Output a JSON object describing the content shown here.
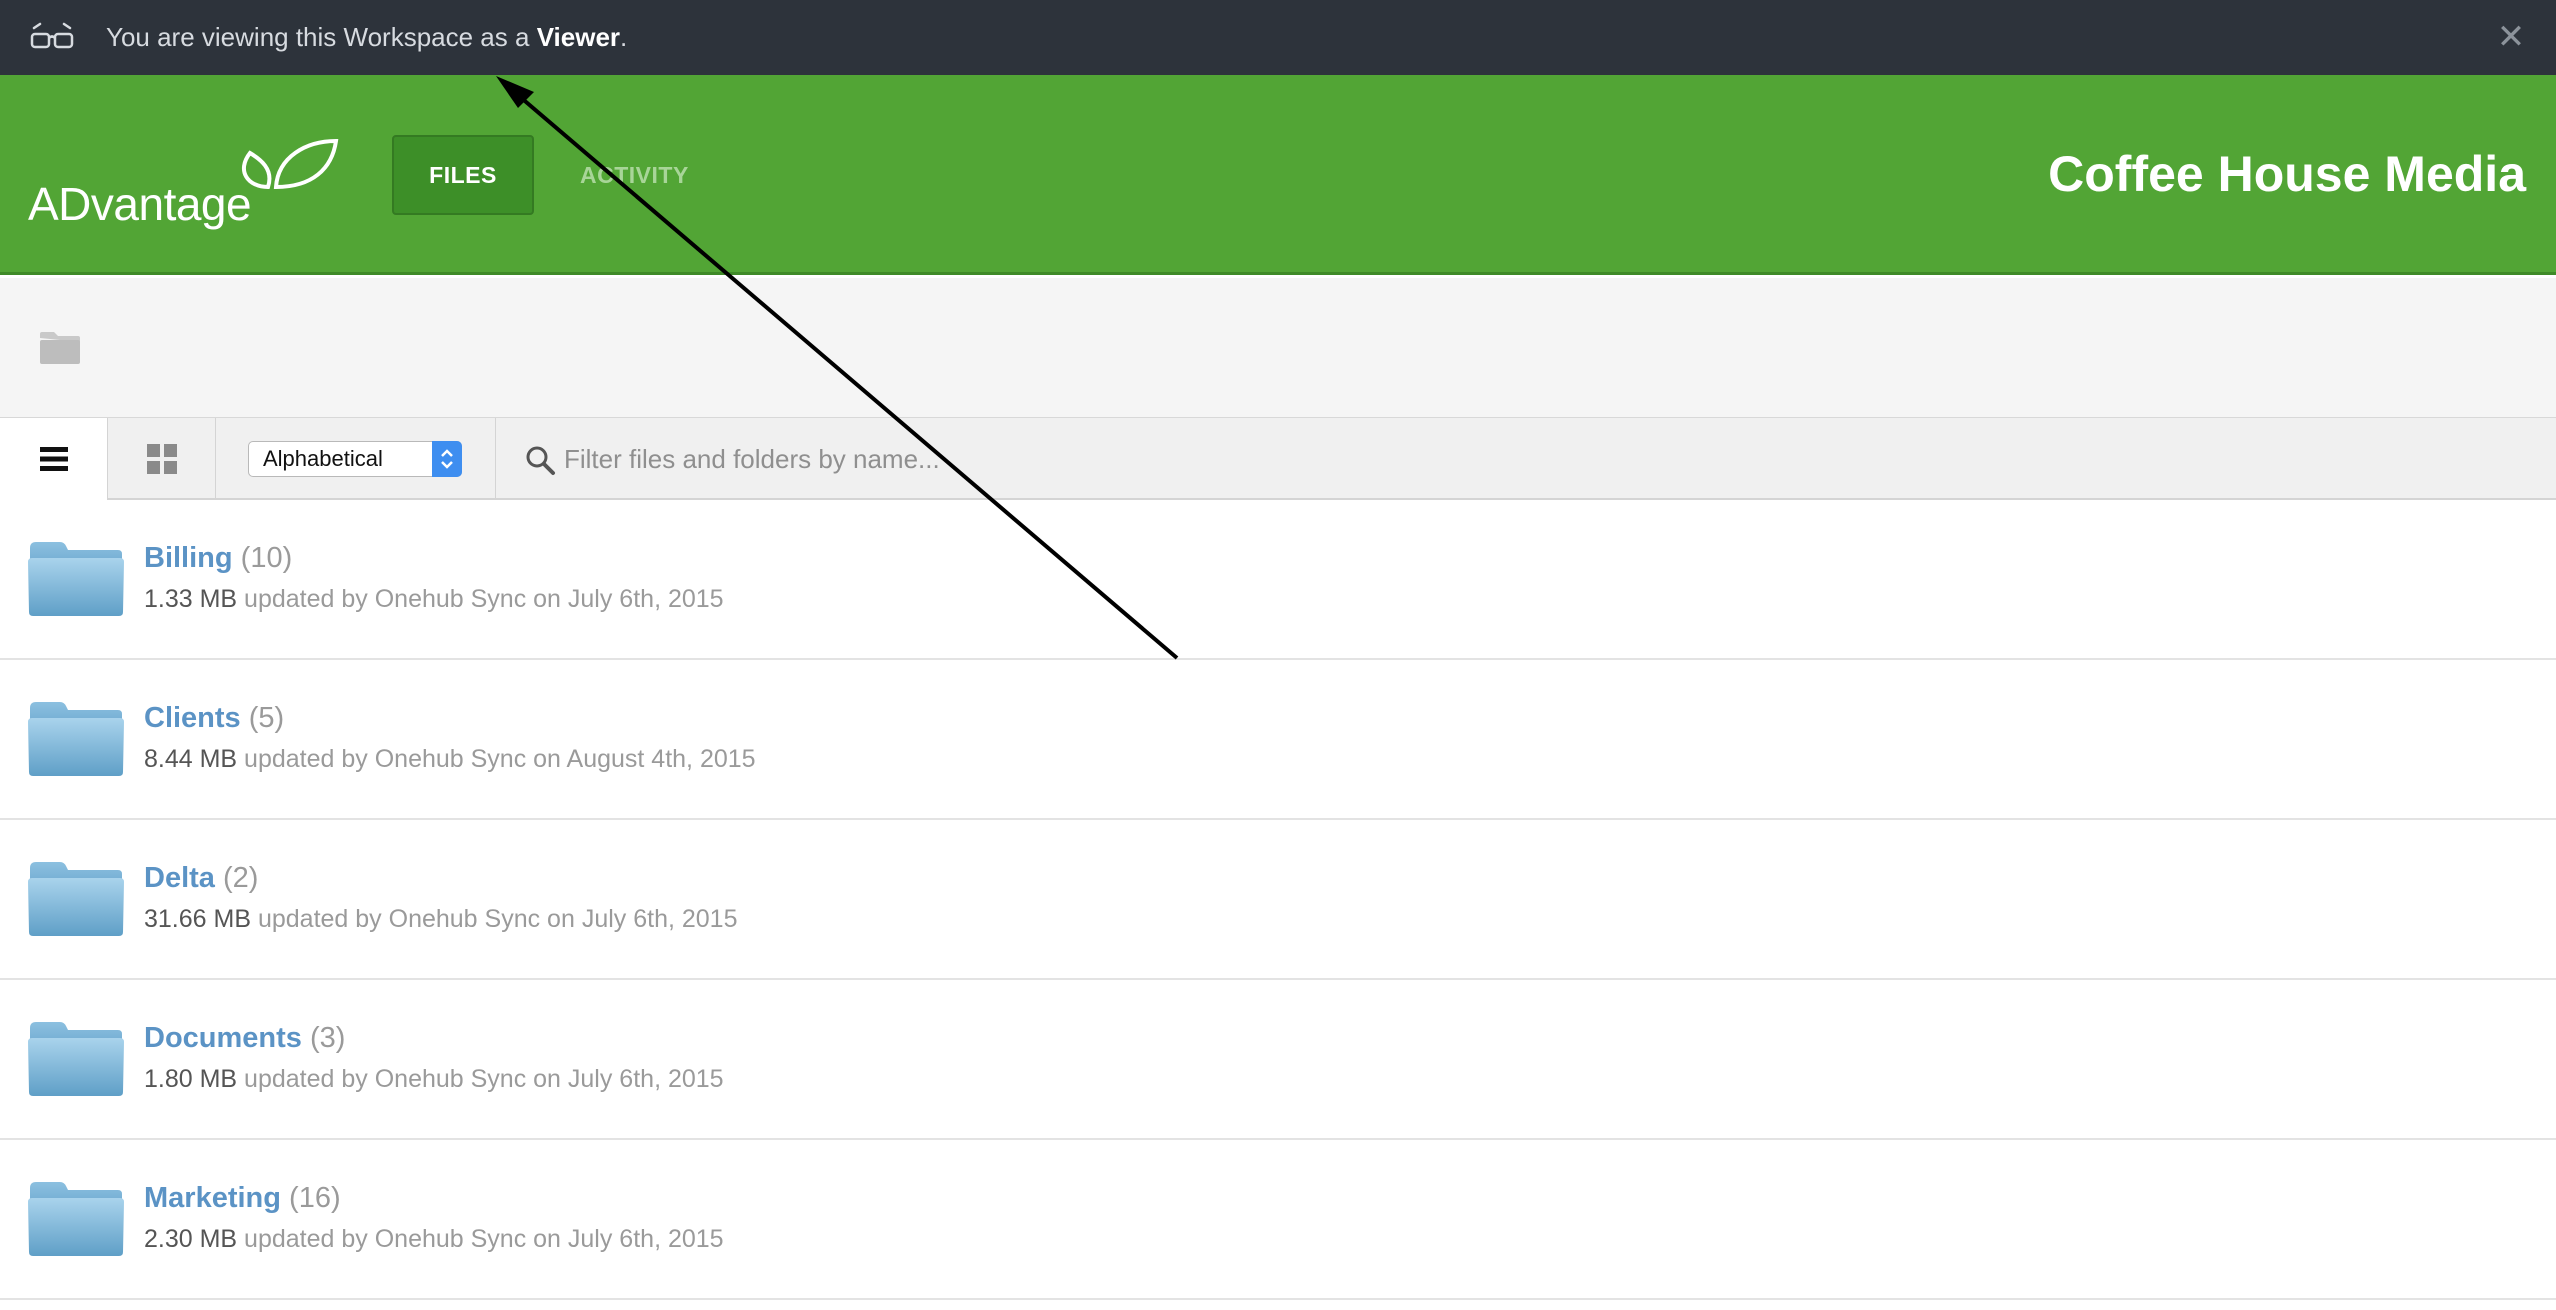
{
  "notice": {
    "prefix": "You are viewing this Workspace as a ",
    "role": "Viewer",
    "suffix": ".",
    "close_icon": "close-icon",
    "glasses_icon": "glasses-icon"
  },
  "header": {
    "logo_text": "ADvantage",
    "nav": [
      {
        "label": "FILES",
        "active": true
      },
      {
        "label": "ACTIVITY",
        "active": false
      }
    ],
    "workspace_name": "Coffee House Media"
  },
  "toolbar": {
    "sort_value": "Alphabetical",
    "filter_placeholder": "Filter files and folders by name..."
  },
  "folders": [
    {
      "name": "Billing",
      "count": "(10)",
      "size": "1.33 MB",
      "meta": " updated by Onehub Sync on July 6th, 2015"
    },
    {
      "name": "Clients",
      "count": "(5)",
      "size": "8.44 MB",
      "meta": " updated by Onehub Sync on August 4th, 2015"
    },
    {
      "name": "Delta",
      "count": "(2)",
      "size": "31.66 MB",
      "meta": " updated by Onehub Sync on July 6th, 2015"
    },
    {
      "name": "Documents",
      "count": "(3)",
      "size": "1.80 MB",
      "meta": " updated by Onehub Sync on July 6th, 2015"
    },
    {
      "name": "Marketing",
      "count": "(16)",
      "size": "2.30 MB",
      "meta": " updated by Onehub Sync on July 6th, 2015"
    }
  ],
  "colors": {
    "header_green": "#52a535",
    "notice_bg": "#2d333b",
    "link_blue": "#5b93c5"
  }
}
